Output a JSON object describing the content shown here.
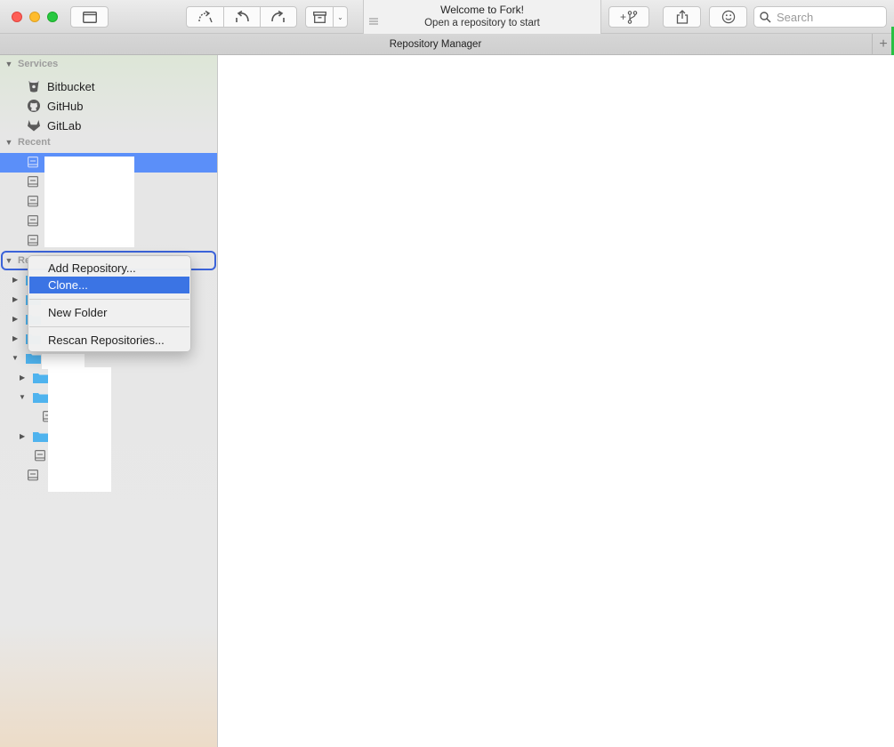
{
  "window": {
    "welcome_title": "Welcome to Fork!",
    "welcome_subtitle": "Open a repository to start"
  },
  "toolbar": {
    "search_placeholder": "Search",
    "buttons": [
      "open-repository",
      "fetch",
      "pull",
      "push",
      "stash",
      "stash-menu",
      "create-branch",
      "share",
      "feedback"
    ]
  },
  "tabs": {
    "active": "Repository Manager",
    "add_label": "+"
  },
  "sidebar": {
    "services_header": "Services",
    "services": [
      {
        "name": "Bitbucket",
        "icon": "bitbucket-icon"
      },
      {
        "name": "GitHub",
        "icon": "github-icon"
      },
      {
        "name": "GitLab",
        "icon": "gitlab-icon"
      }
    ],
    "recent_header": "Recent",
    "recent_count": 5,
    "repositories_header": "Re"
  },
  "context_menu": {
    "items": [
      "Add Repository...",
      "Clone...",
      "New Folder",
      "Rescan Repositories..."
    ],
    "highlighted": "Clone..."
  },
  "colors": {
    "selection": "#5b8ff9",
    "menu_highlight": "#3b74e4",
    "focus_ring": "#3b63d9",
    "folder": "#4fb3ee"
  }
}
